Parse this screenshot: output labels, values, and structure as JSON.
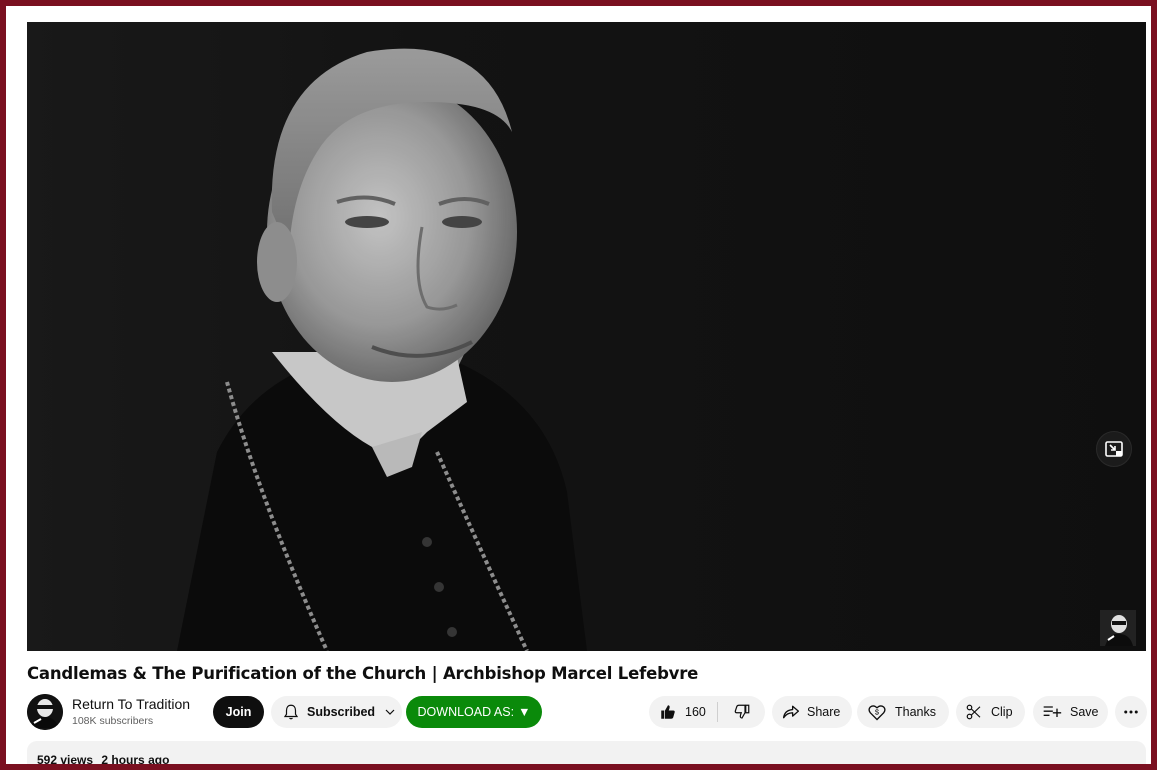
{
  "video": {
    "title": "Candlemas & The Purification of the Church | Archbishop Marcel Lefebvre"
  },
  "channel": {
    "name": "Return To Tradition",
    "subscribers": "108K subscribers"
  },
  "actions": {
    "join_label": "Join",
    "subscribed_label": "Subscribed",
    "download_label": "DOWNLOAD AS:",
    "download_arrow": "▼",
    "like_count": "160",
    "share_label": "Share",
    "thanks_label": "Thanks",
    "clip_label": "Clip",
    "save_label": "Save"
  },
  "description": {
    "views": "592 views",
    "age": "2 hours ago"
  },
  "icons": {
    "like": "thumbs-up-icon",
    "dislike": "thumbs-down-icon",
    "bell": "bell-icon",
    "share": "share-icon",
    "thanks": "thanks-icon",
    "clip": "scissors-icon",
    "save": "playlist-add-icon",
    "more": "more-icon",
    "miniplayer": "miniplayer-icon"
  },
  "colors": {
    "border": "#7a1020",
    "download_button": "#0a8a0a",
    "join_button": "#0f0f0f"
  }
}
